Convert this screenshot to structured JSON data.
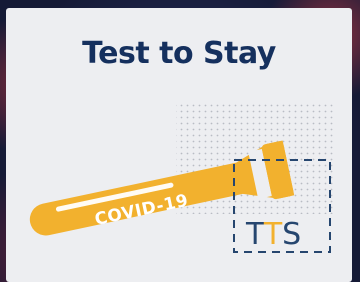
{
  "card": {
    "title": "Test to Stay"
  },
  "illustration": {
    "tube_label": "COVID-19",
    "badge_text_left": "T",
    "badge_text_middle": "T",
    "badge_text_right": "S"
  },
  "colors": {
    "title": "#15305e",
    "tube": "#f2b12e",
    "badge_navy": "#26466f",
    "badge_accent": "#f2b12e",
    "card_background": "#edeef1"
  }
}
